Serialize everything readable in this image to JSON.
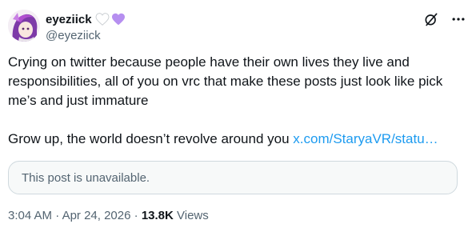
{
  "author": {
    "display_name": "eyeziick",
    "handle": "@eyeziick",
    "badge_icons": [
      "white-heart-icon",
      "purple-heart-icon"
    ],
    "avatar_icon": "avatar-image"
  },
  "actions": {
    "grok_icon": "grok-icon",
    "more_icon": "more-options-icon"
  },
  "post": {
    "paragraph1": "Crying on twitter because people have their own lives they live and responsibilities, all of you on vrc that make these posts just look like pick me’s and just immature",
    "paragraph2_text": "Grow up, the world doesn’t revolve around you ",
    "paragraph2_link": "x.com/StaryaVR/statu…"
  },
  "quote": {
    "text": "This post is unavailable."
  },
  "meta": {
    "time": "3:04 AM",
    "date": "Apr 24, 2026",
    "views_count": "13.8K",
    "views_label": "Views",
    "separator": "·"
  },
  "colors": {
    "text": "#0f1419",
    "secondary": "#536471",
    "link": "#1d9bf0",
    "heart_purple": "#b68ff0",
    "heart_white": "#ffffff"
  }
}
